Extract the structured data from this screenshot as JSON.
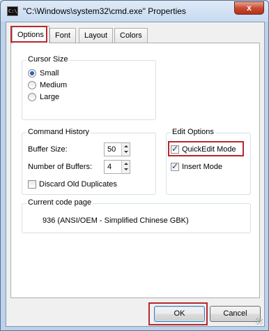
{
  "window": {
    "title": "\"C:\\Windows\\system32\\cmd.exe\" Properties",
    "icon_text": "C:\\",
    "close_label": "x"
  },
  "tabs": [
    {
      "label": "Options",
      "active": true
    },
    {
      "label": "Font",
      "active": false
    },
    {
      "label": "Layout",
      "active": false
    },
    {
      "label": "Colors",
      "active": false
    }
  ],
  "cursor_size": {
    "title": "Cursor Size",
    "options": [
      {
        "label": "Small",
        "checked": true
      },
      {
        "label": "Medium",
        "checked": false
      },
      {
        "label": "Large",
        "checked": false
      }
    ]
  },
  "command_history": {
    "title": "Command History",
    "buffer_size_label": "Buffer Size:",
    "buffer_size_value": "50",
    "num_buffers_label": "Number of Buffers:",
    "num_buffers_value": "4",
    "discard_label": "Discard Old Duplicates",
    "discard_checked": false
  },
  "edit_options": {
    "title": "Edit Options",
    "quickedit_label": "QuickEdit Mode",
    "quickedit_checked": true,
    "insert_label": "Insert Mode",
    "insert_checked": true
  },
  "code_page": {
    "title": "Current code page",
    "value": "936   (ANSI/OEM - Simplified Chinese GBK)"
  },
  "buttons": {
    "ok": "OK",
    "cancel": "Cancel"
  },
  "icons": {
    "check": "✓"
  },
  "colors": {
    "highlight": "#b8282e",
    "radio_selected": "#2266bb"
  }
}
